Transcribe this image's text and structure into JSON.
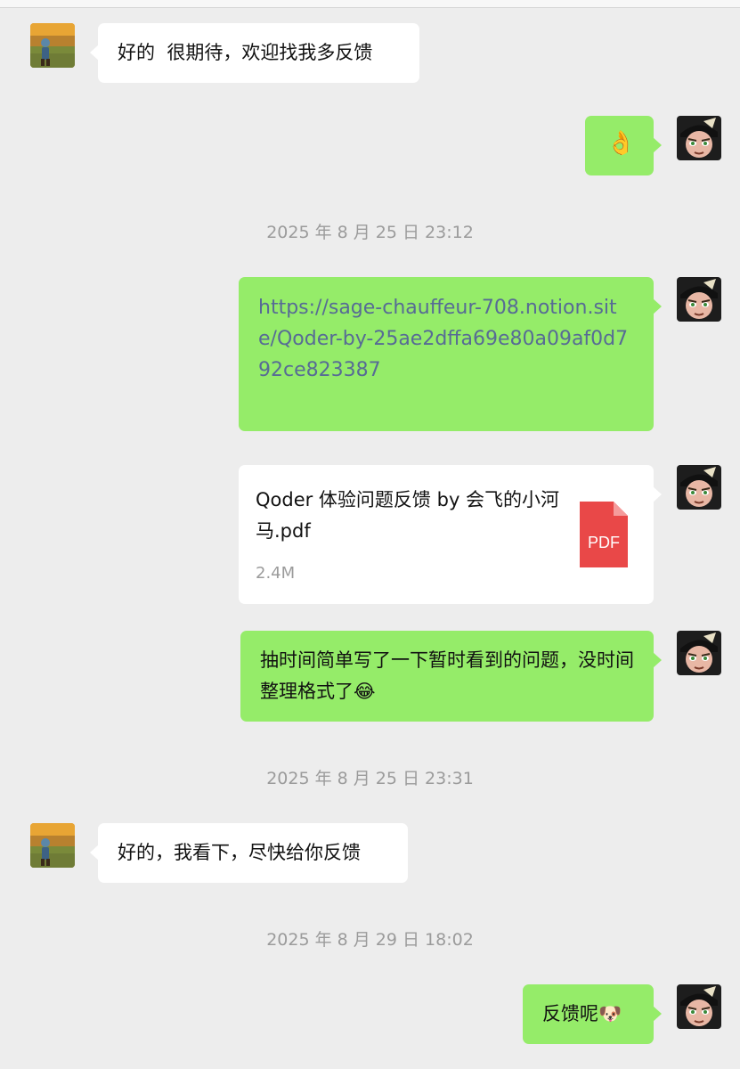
{
  "messages": {
    "m1": {
      "text": "好的  很期待，欢迎找我多反馈"
    },
    "m2": {
      "emoji": "👌"
    },
    "ts1": "2025 年 8 月 25 日 23:12",
    "m3": {
      "text": "https://sage-chauffeur-708.notion.site/Qoder-by-25ae2dffa69e80a09af0d792ce823387"
    },
    "m4": {
      "file_name": "Qoder 体验问题反馈 by 会飞的小河马.pdf",
      "file_size": "2.4M",
      "file_type": "PDF"
    },
    "m5": {
      "text": "抽时间简单写了一下暂时看到的问题，没时间整理格式了😂"
    },
    "ts2": "2025 年 8 月 25 日 23:31",
    "m6": {
      "text": "好的，我看下，尽快给你反馈"
    },
    "ts3": "2025 年 8 月 29 日 18:02",
    "m7": {
      "text": "反馈呢🐶"
    }
  },
  "colors": {
    "bubble_self": "#95ec69",
    "bubble_other": "#ffffff",
    "background": "#ededed",
    "link": "#576b95",
    "pdf_red": "#e94848"
  },
  "icons": {
    "other_avatar": "landscape-figure-avatar",
    "self_avatar": "cartoon-pirate-avatar",
    "file": "pdf-file-icon"
  }
}
